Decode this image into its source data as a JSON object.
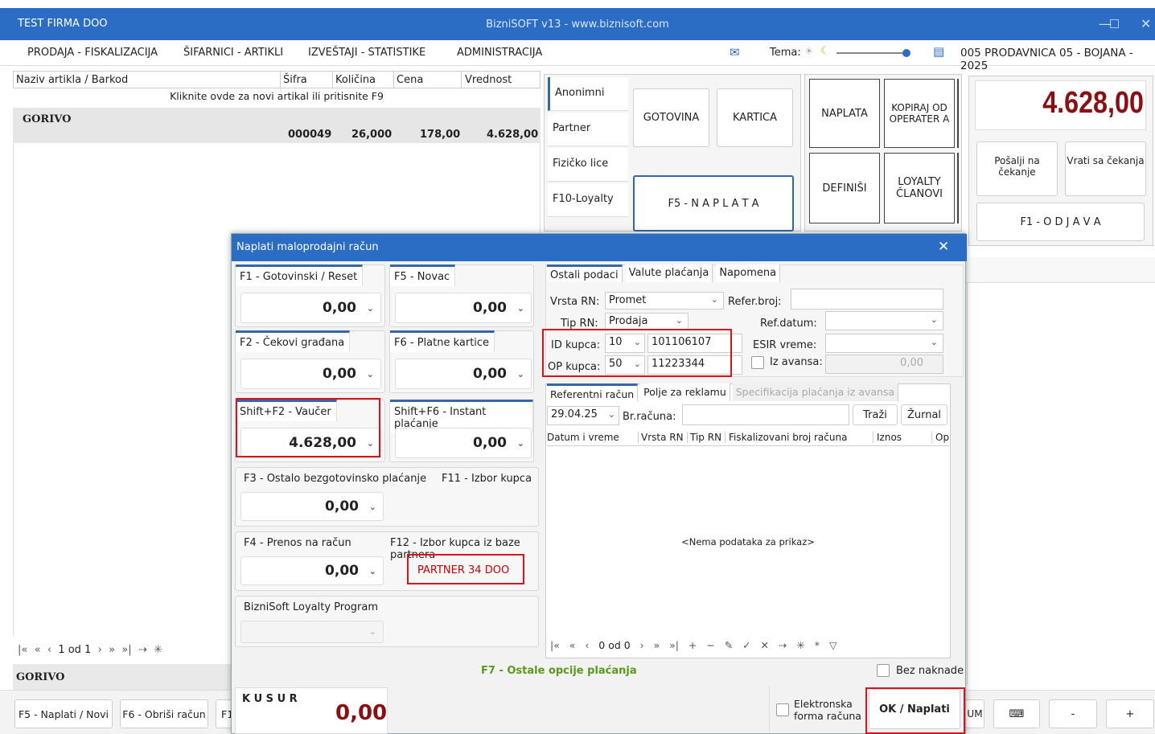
{
  "title_bar": {
    "company": "TEST FIRMA DOO",
    "app_title": "BizniSOFT v13 - www.biznisoft.com"
  },
  "menu": {
    "items": [
      "PRODAJA - FISKALIZACIJA",
      "ŠIFARNICI - ARTIKLI",
      "IZVEŠTAJI - STATISTIKE",
      "ADMINISTRACIJA"
    ],
    "theme_label": "Tema:",
    "store": "005 PRODAVNICA 05 - BOJANA - 2025"
  },
  "grid": {
    "columns": [
      "Naziv artikla / Barkod",
      "Šifra",
      "Količina",
      "Cena",
      "Vrednost"
    ],
    "new_row_hint": "Kliknite ovde za novi artikal ili pritisnite F9",
    "group": "GORIVO",
    "row": {
      "sifra": "000049",
      "kolicina": "26,000",
      "cena": "178,00",
      "vrednost": "4.628,00"
    },
    "pager": "1 od 1",
    "footer_group": "GORIVO"
  },
  "side_tabs": [
    "Anonimni",
    "Partner",
    "Fizičko lice",
    "F10-Loyalty"
  ],
  "buttons": {
    "gotovina": "GOTOVINA",
    "kartica": "KARTICA",
    "naplata_f5": "F5 - N A P L A T A",
    "naplata": "NAPLATA",
    "kopiraj": "KOPIRAJ OD OPERATER A",
    "definisi": "DEFINIŠI",
    "loyalty": "LOYALTY ČLANOVI",
    "posalji": "Pošalji na čekanje",
    "vrati": "Vrati sa čekanja",
    "odjava": "F1 - O D J A V A"
  },
  "total": "4.628,00",
  "bottom_buttons": [
    "F5 - Naplati / Novi",
    "F6 - Obriši račun",
    "F1"
  ],
  "bottom_right": {
    "partial": "UM",
    "minus": "-",
    "plus": "+"
  },
  "modal": {
    "title": "Naplati maloprodajni račun",
    "payments": [
      {
        "label": "F1 - Gotovinski / Reset",
        "value": "0,00"
      },
      {
        "label": "F5 - Novac",
        "value": "0,00"
      },
      {
        "label": "F2 - Čekovi građana",
        "value": "0,00"
      },
      {
        "label": "F6 - Platne kartice",
        "value": "0,00"
      },
      {
        "label": "Shift+F2 - Vaučer",
        "value": "4.628,00"
      },
      {
        "label": "Shift+F6 - Instant plaćanje",
        "value": "0,00"
      }
    ],
    "ostalo_label": "F3 - Ostalo bezgotovinsko plaćanje",
    "f11_label": "F11 - Izbor kupca",
    "ostalo_value": "0,00",
    "prenos_label": "F4 - Prenos na račun",
    "f12_label": "F12 - Izbor kupca iz baze partnera",
    "prenos_value": "0,00",
    "partner": "PARTNER 34 DOO",
    "loyalty_label": "BizniSoft Loyalty Program",
    "tabs": [
      "Ostali podaci",
      "Valute plaćanja",
      "Napomena"
    ],
    "fields": {
      "vrsta_rn_label": "Vrsta RN:",
      "vrsta_rn": "Promet",
      "refer_label": "Refer.broj:",
      "tip_rn_label": "Tip RN:",
      "tip_rn": "Prodaja",
      "ref_datum_label": "Ref.datum:",
      "id_kupca_label": "ID kupca:",
      "id_code": "10",
      "id_value": "101106107",
      "esir_label": "ESIR vreme:",
      "op_kupca_label": "OP kupca:",
      "op_code": "50",
      "op_value": "11223344",
      "avans_label": "Iz avansa:",
      "avans_value": "0,00"
    },
    "subtabs": [
      "Referentni račun",
      "Polje za reklamu",
      "Specifikacija plaćanja iz avansa"
    ],
    "ref": {
      "date": "29.04.25",
      "br_label": "Br.računa:",
      "trazi": "Traži",
      "zurnal": "Žurnal",
      "cols": [
        "Datum i vreme",
        "Vrsta RN",
        "Tip RN",
        "Fiskalizovani broj računa",
        "Iznos",
        "Op"
      ],
      "empty": "<Nema podataka za prikaz>",
      "pager": "0 od 0"
    },
    "bez_naknade": "Bez naknade",
    "f7": "F7 - Ostale opcije plaćanja",
    "kusur_label": "K U S U R",
    "kusur_value": "0,00",
    "elektronska": "Elektronska forma računa",
    "ok": "OK / Naplati"
  }
}
